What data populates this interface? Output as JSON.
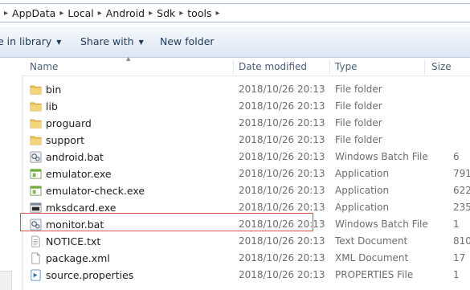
{
  "breadcrumb": [
    "AppData",
    "Local",
    "Android",
    "Sdk",
    "tools"
  ],
  "toolbar": {
    "include_label": "e in library",
    "share_label": "Share with",
    "new_folder_label": "New folder"
  },
  "columns": {
    "name": "Name",
    "date": "Date modified",
    "type": "Type",
    "size": "Size"
  },
  "files": [
    {
      "name": "bin",
      "date": "2018/10/26 20:13",
      "type": "File folder",
      "size": "",
      "icon": "folder-icon"
    },
    {
      "name": "lib",
      "date": "2018/10/26 20:13",
      "type": "File folder",
      "size": "",
      "icon": "folder-icon"
    },
    {
      "name": "proguard",
      "date": "2018/10/26 20:13",
      "type": "File folder",
      "size": "",
      "icon": "folder-icon"
    },
    {
      "name": "support",
      "date": "2018/10/26 20:13",
      "type": "File folder",
      "size": "",
      "icon": "folder-icon"
    },
    {
      "name": "android.bat",
      "date": "2018/10/26 20:13",
      "type": "Windows Batch File",
      "size": "6",
      "icon": "batch-file-icon"
    },
    {
      "name": "emulator.exe",
      "date": "2018/10/26 20:13",
      "type": "Application",
      "size": "791",
      "icon": "application-icon"
    },
    {
      "name": "emulator-check.exe",
      "date": "2018/10/26 20:13",
      "type": "Application",
      "size": "622",
      "icon": "application-icon"
    },
    {
      "name": "mksdcard.exe",
      "date": "2018/10/26 20:13",
      "type": "Application",
      "size": "235",
      "icon": "console-app-icon"
    },
    {
      "name": "monitor.bat",
      "date": "2018/10/26 20:13",
      "type": "Windows Batch File",
      "size": "1",
      "icon": "batch-file-icon"
    },
    {
      "name": "NOTICE.txt",
      "date": "2018/10/26 20:13",
      "type": "Text Document",
      "size": "810",
      "icon": "text-file-icon"
    },
    {
      "name": "package.xml",
      "date": "2018/10/26 20:13",
      "type": "XML Document",
      "size": "17",
      "icon": "document-icon"
    },
    {
      "name": "source.properties",
      "date": "2018/10/26 20:13",
      "type": "PROPERTIES File",
      "size": "1",
      "icon": "properties-file-icon"
    }
  ],
  "colors": {
    "highlight_border": "#d9534f",
    "folder": "#e8c25a",
    "toolbar_text": "#1e395b"
  }
}
